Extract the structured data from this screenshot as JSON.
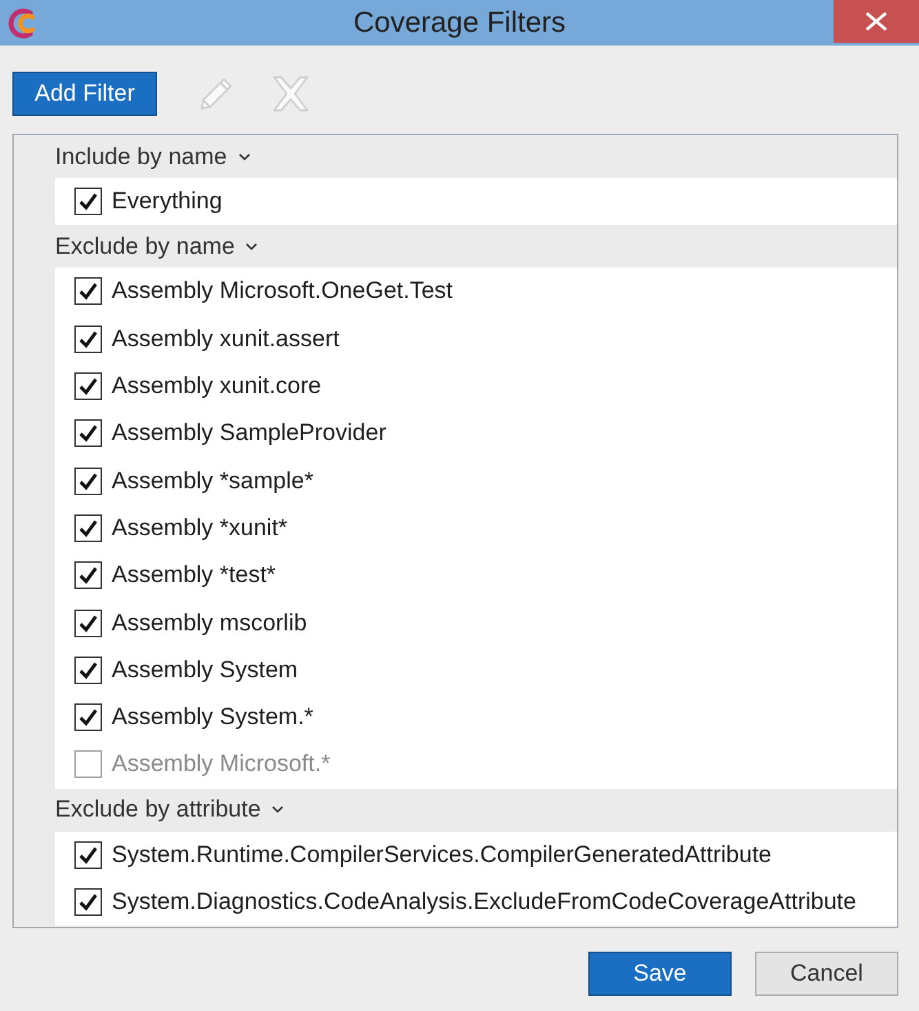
{
  "window": {
    "title": "Coverage Filters"
  },
  "toolbar": {
    "add_button": {
      "label": "Add Filter",
      "disabled": false
    },
    "edit_button": {
      "disabled": true
    },
    "remove_button": {
      "disabled": true
    }
  },
  "groups": [
    {
      "title": "Include by name",
      "expanded": true,
      "items": [
        {
          "label": "Everything",
          "checked": true
        }
      ]
    },
    {
      "title": "Exclude by name",
      "expanded": true,
      "items": [
        {
          "label": "Assembly Microsoft.OneGet.Test",
          "checked": true
        },
        {
          "label": "Assembly xunit.assert",
          "checked": true
        },
        {
          "label": "Assembly xunit.core",
          "checked": true
        },
        {
          "label": "Assembly SampleProvider",
          "checked": true
        },
        {
          "label": "Assembly *sample*",
          "checked": true
        },
        {
          "label": "Assembly *xunit*",
          "checked": true
        },
        {
          "label": "Assembly *test*",
          "checked": true
        },
        {
          "label": "Assembly mscorlib",
          "checked": true
        },
        {
          "label": "Assembly System",
          "checked": true
        },
        {
          "label": "Assembly System.*",
          "checked": true
        },
        {
          "label": "Assembly Microsoft.*",
          "checked": false
        }
      ]
    },
    {
      "title": "Exclude by attribute",
      "expanded": true,
      "items": [
        {
          "label": "System.Runtime.CompilerServices.CompilerGeneratedAttribute",
          "checked": true
        },
        {
          "label": "System.Diagnostics.CodeAnalysis.ExcludeFromCodeCoverageAttribute",
          "checked": true
        }
      ]
    }
  ],
  "buttons": [
    {
      "label": "Save",
      "kind": "primary"
    },
    {
      "label": "Cancel",
      "kind": "secondary"
    }
  ]
}
